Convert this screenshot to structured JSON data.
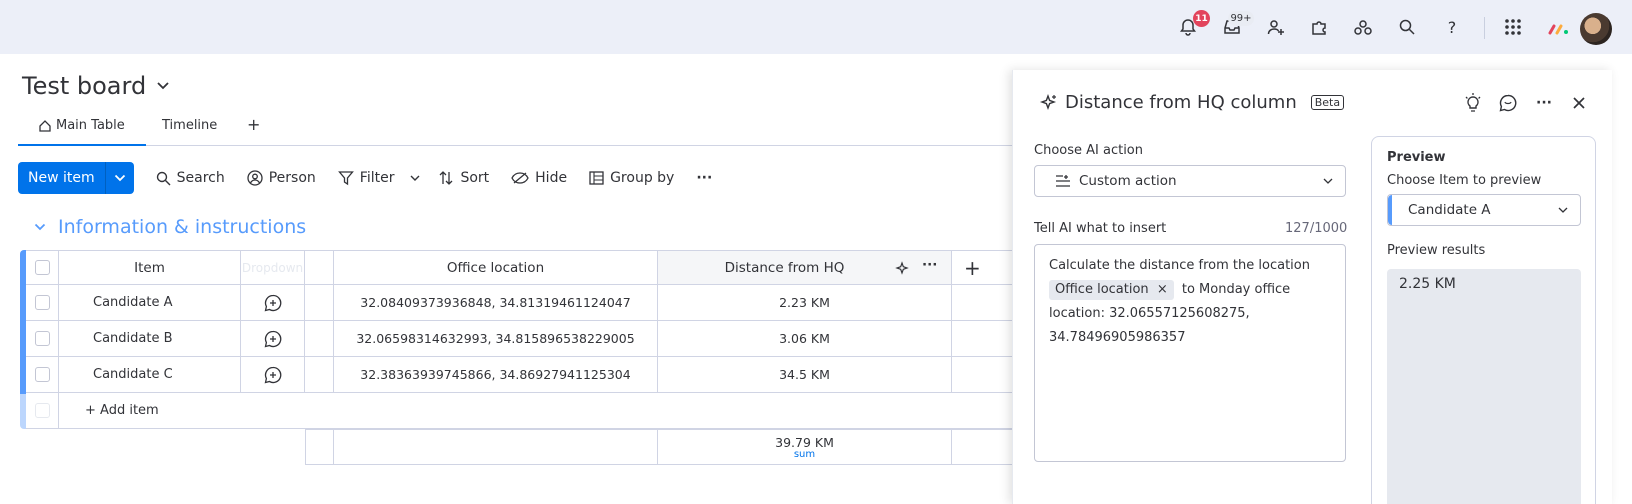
{
  "topbar": {
    "notifications_count": "11",
    "inbox_count": "99+",
    "icons": [
      "bell-icon",
      "inbox-icon",
      "invite-members-icon",
      "apps-icon",
      "integrations-icon",
      "search-icon",
      "help-icon",
      "app-switcher-icon",
      "monday-logo",
      "avatar"
    ]
  },
  "board": {
    "title": "Test board",
    "tabs": [
      {
        "label": "Main Table",
        "active": true
      },
      {
        "label": "Timeline",
        "active": false
      }
    ],
    "add_view": "+"
  },
  "toolbar": {
    "new_item": "New item",
    "search": "Search",
    "person": "Person",
    "filter": "Filter",
    "sort": "Sort",
    "hide": "Hide",
    "group_by": "Group by",
    "more": "···"
  },
  "group": {
    "title": "Information & instructions",
    "color": "#579bfc",
    "columns": {
      "item": "Item",
      "dropdown": "Dropdown",
      "office_location": "Office location",
      "distance": "Distance from HQ",
      "add": "+"
    },
    "rows": [
      {
        "item": "Candidate A",
        "office_location": "32.08409373936848, 34.81319461124047",
        "distance": "2.23 KM"
      },
      {
        "item": "Candidate B",
        "office_location": "32.06598314632993, 34.815896538229005",
        "distance": "3.06 KM"
      },
      {
        "item": "Candidate C",
        "office_location": "32.38363939745866, 34.86927941125304",
        "distance": "34.5 KM"
      }
    ],
    "add_item": "+ Add item",
    "summary": {
      "value": "39.79 KM",
      "label": "sum"
    }
  },
  "panel": {
    "title": "Distance from HQ column",
    "badge": "Beta",
    "choose_action_label": "Choose AI action",
    "action_value": "Custom action",
    "insert_label": "Tell AI what to insert",
    "char_count": "127/1000",
    "prompt_before": "Calculate the distance from the location",
    "prompt_chip": "Office location",
    "prompt_after_1": "to Monday office",
    "prompt_after_2": "location: 32.06557125608275,",
    "prompt_after_3": "34.78496905986357",
    "preview_title": "Preview",
    "choose_item_label": "Choose Item to preview",
    "preview_item": "Candidate A",
    "preview_results_label": "Preview results",
    "preview_result": "2.25 KM"
  },
  "colors": {
    "accent": "#0073ea",
    "group_blue": "#579bfc",
    "topbar_bg": "#eceff8",
    "badge_red": "#e2445c"
  }
}
